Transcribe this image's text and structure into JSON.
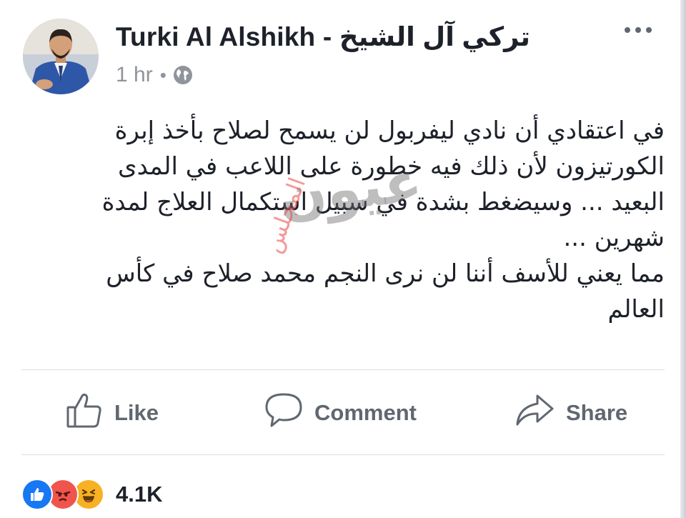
{
  "post": {
    "author": "Turki Al Alshikh - تركي آل الشيخ",
    "time": "1 hr",
    "meta_separator": "•",
    "privacy_icon": "globe-icon",
    "body_lines": [
      "في اعتقادي أن نادي ليفربول لن يسمح لصلاح بأخذ إبرة",
      "الكورتيزون لأن ذلك فيه خطورة على اللاعب في المدى",
      "البعيد ... وسيضغط بشدة في سبيل استكمال العلاج لمدة",
      "شهرين ...",
      "مما يعني للأسف أننا لن نرى النجم محمد صلاح في كأس",
      "العالم"
    ],
    "watermark": {
      "main": "عيون",
      "sub": "المجلس"
    }
  },
  "actions": {
    "like_label": "Like",
    "comment_label": "Comment",
    "share_label": "Share"
  },
  "reactions": {
    "types": [
      "like",
      "angry",
      "haha"
    ],
    "count": "4.1K"
  },
  "colors": {
    "text": "#1d2129",
    "secondary": "#90949c",
    "action": "#606770",
    "like_blue": "#1877f2",
    "angry_red": "#f0554d",
    "haha_yellow": "#f7b125"
  }
}
